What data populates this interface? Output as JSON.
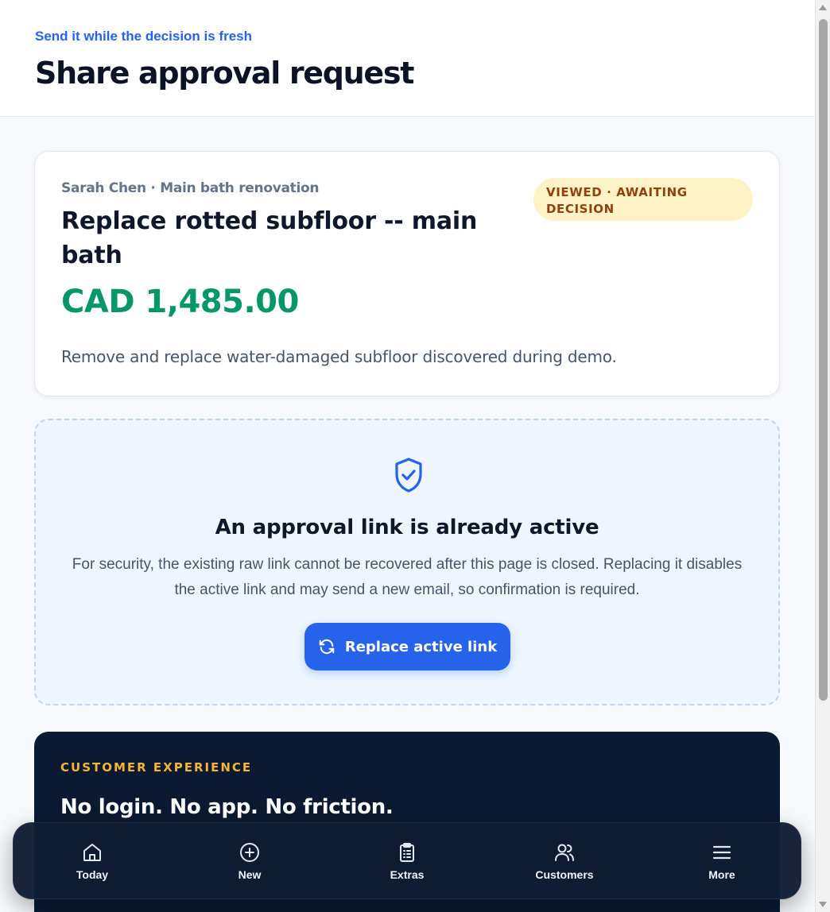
{
  "header": {
    "eyebrow": "Send it while the decision is fresh",
    "title": "Share approval request"
  },
  "request": {
    "meta": "Sarah Chen · Main bath renovation",
    "title": "Replace rotted subfloor -- main bath",
    "amount": "CAD 1,485.00",
    "description": "Remove and replace water-damaged subfloor discovered during demo.",
    "status": "Viewed · Awaiting decision"
  },
  "active_link": {
    "icon": "shield-check-icon",
    "title": "An approval link is already active",
    "text": "For security, the existing raw link cannot be recovered after this page is closed. Replacing it disables the active link and may send a new email, so confirmation is required.",
    "button_label": "Replace active link",
    "button_icon": "refresh-icon"
  },
  "customer_experience": {
    "eyebrow": "CUSTOMER EXPERIENCE",
    "title": "No login. No app. No friction."
  },
  "bottom_nav": {
    "items": [
      {
        "label": "Today",
        "icon": "home-icon"
      },
      {
        "label": "New",
        "icon": "plus-circle-icon"
      },
      {
        "label": "Extras",
        "icon": "clipboard-icon"
      },
      {
        "label": "Customers",
        "icon": "users-icon"
      },
      {
        "label": "More",
        "icon": "menu-icon"
      }
    ]
  },
  "colors": {
    "accent": "#2563eb",
    "amount": "#059669",
    "badge_bg": "#fef3c7",
    "badge_text": "#92400e",
    "dark_bg": "#0b1a32",
    "eyebrow_dark": "#f5b431"
  }
}
